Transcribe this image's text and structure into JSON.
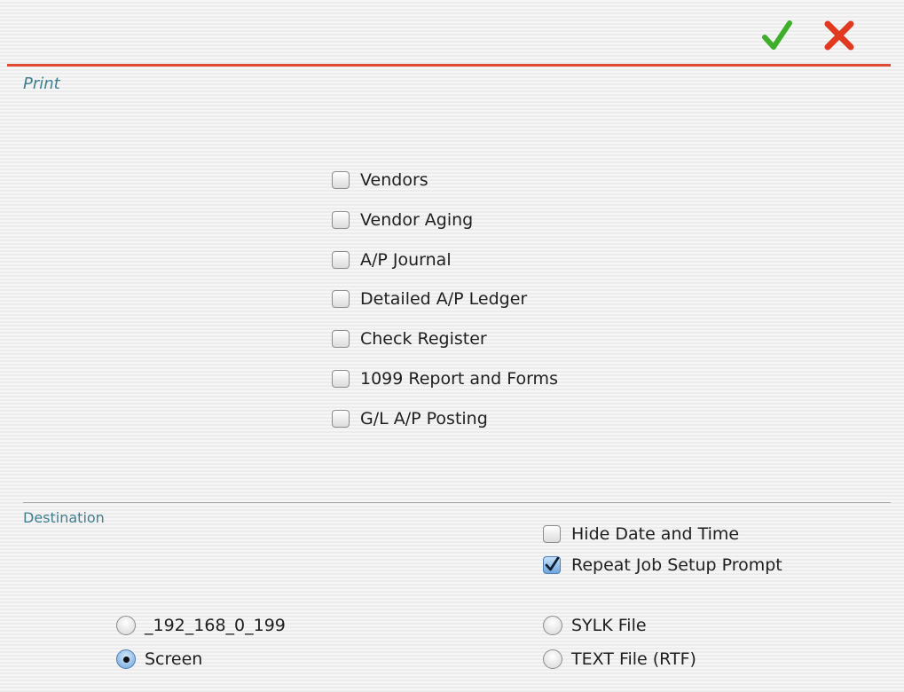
{
  "toolbar": {
    "ok_icon": "checkmark-icon",
    "cancel_icon": "close-icon",
    "ok_color": "#3fae2a",
    "cancel_color": "#e0391f"
  },
  "sections": {
    "print_label": "Print",
    "destination_label": "Destination"
  },
  "reports": [
    {
      "label": "Vendors",
      "checked": false
    },
    {
      "label": "Vendor Aging",
      "checked": false
    },
    {
      "label": "A/P Journal",
      "checked": false
    },
    {
      "label": "Detailed A/P Ledger",
      "checked": false
    },
    {
      "label": "Check Register",
      "checked": false
    },
    {
      "label": "1099 Report and Forms",
      "checked": false
    },
    {
      "label": "G/L A/P Posting",
      "checked": false
    }
  ],
  "options": {
    "hide_date_time": {
      "label": "Hide Date and Time",
      "checked": false
    },
    "repeat_job_setup": {
      "label": "Repeat Job Setup Prompt",
      "checked": true
    }
  },
  "destinations": [
    {
      "label": "_192_168_0_199",
      "selected": false
    },
    {
      "label": "Screen",
      "selected": true
    },
    {
      "label": "SYLK File",
      "selected": false
    },
    {
      "label": "TEXT File (RTF)",
      "selected": false
    }
  ],
  "colors": {
    "accent_divider": "#e04a32",
    "section_label": "#3f7f8f"
  }
}
